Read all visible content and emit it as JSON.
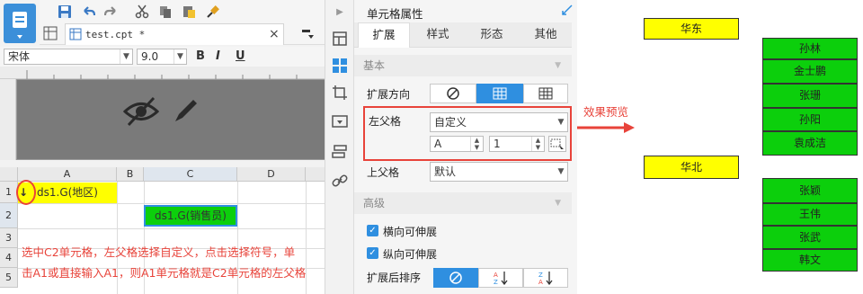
{
  "file_tab": {
    "name": "test.cpt *",
    "close": "×"
  },
  "font": {
    "family": "宋体",
    "size": "9.0",
    "bold": "B",
    "italic": "I",
    "underline": "U"
  },
  "grid": {
    "columns": [
      "A",
      "B",
      "C",
      "D"
    ],
    "rows": [
      "1",
      "2",
      "3",
      "4",
      "5"
    ],
    "cell_a1": "ds1.G(地区)",
    "cell_c2": "ds1.G(销售员)",
    "instruction_line1": "选中C2单元格，左父格选择自定义，点击选择符号，单",
    "instruction_line2": "击A1或直接输入A1，则A1单元格就是C2单元格的左父格"
  },
  "panel": {
    "title": "单元格属性",
    "tabs": [
      "扩展",
      "样式",
      "形态",
      "其他"
    ],
    "section_basic": "基本",
    "expand_dir_label": "扩展方向",
    "left_parent_label": "左父格",
    "left_parent_value": "自定义",
    "left_parent_col": "A",
    "left_parent_row": "1",
    "upper_parent_label": "上父格",
    "upper_parent_value": "默认",
    "section_advanced": "高级",
    "horizontal_expand": "横向可伸展",
    "vertical_expand": "纵向可伸展",
    "sort_label": "扩展后排序"
  },
  "annotation": {
    "preview": "效果预览"
  },
  "preview": {
    "group1": {
      "region": "华东",
      "people": [
        "孙林",
        "金士鹏",
        "张珊",
        "孙阳",
        "袁成洁"
      ]
    },
    "group2": {
      "region": "华北",
      "people": [
        "张颖",
        "王伟",
        "张武",
        "韩文"
      ]
    }
  },
  "colors": {
    "accent": "#2f8fe0",
    "highlight_red": "#e8433a",
    "yellow": "#ffff00",
    "green": "#0ccf0c"
  }
}
